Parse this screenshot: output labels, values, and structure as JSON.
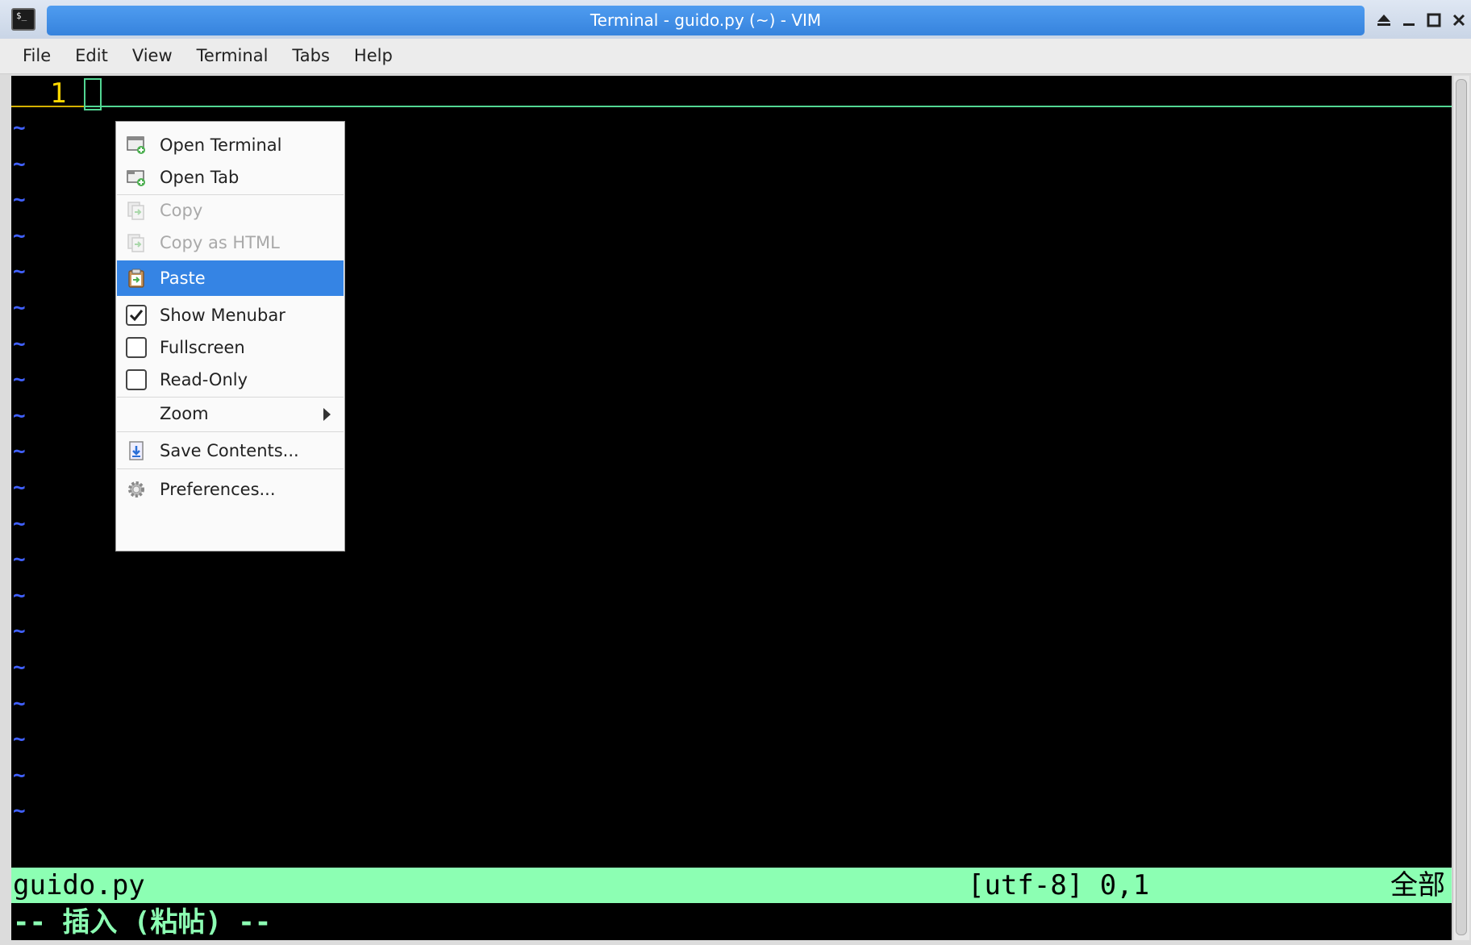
{
  "window": {
    "title": "Terminal - guido.py (~) - VIM",
    "app_icon_text": "$_",
    "controls": [
      "shade",
      "minimize",
      "maximize",
      "close"
    ]
  },
  "menubar": {
    "items": [
      "File",
      "Edit",
      "View",
      "Terminal",
      "Tabs",
      "Help"
    ]
  },
  "editor": {
    "line_number": "1",
    "tilde": "~",
    "tilde_count": 20,
    "colors": {
      "background": "#000000",
      "line_number": "#ffd700",
      "tilde": "#4060ff",
      "status_bg": "#8cffb3"
    }
  },
  "statusline": {
    "filename": "guido.py",
    "encoding_position": "[utf-8] 0,1",
    "scroll": "全部"
  },
  "modeline": "-- 插入 (粘帖) --",
  "context_menu": {
    "items": [
      {
        "label": "Open Terminal",
        "icon": "open-terminal-icon",
        "state": "enabled"
      },
      {
        "label": "Open Tab",
        "icon": "open-tab-icon",
        "state": "enabled"
      },
      {
        "label": "Copy",
        "icon": "copy-icon",
        "state": "disabled"
      },
      {
        "label": "Copy as HTML",
        "icon": "copy-html-icon",
        "state": "disabled"
      },
      {
        "label": "Paste",
        "icon": "paste-icon",
        "state": "highlighted"
      },
      {
        "label": "Show Menubar",
        "icon": "checkbox",
        "checked": true
      },
      {
        "label": "Fullscreen",
        "icon": "checkbox",
        "checked": false
      },
      {
        "label": "Read-Only",
        "icon": "checkbox",
        "checked": false
      },
      {
        "label": "Zoom",
        "icon": "submenu-arrow",
        "state": "enabled"
      },
      {
        "label": "Save Contents...",
        "icon": "save-icon",
        "state": "enabled"
      },
      {
        "label": "Preferences...",
        "icon": "gear-icon",
        "state": "enabled"
      }
    ],
    "highlight_color": "#3584e4"
  }
}
